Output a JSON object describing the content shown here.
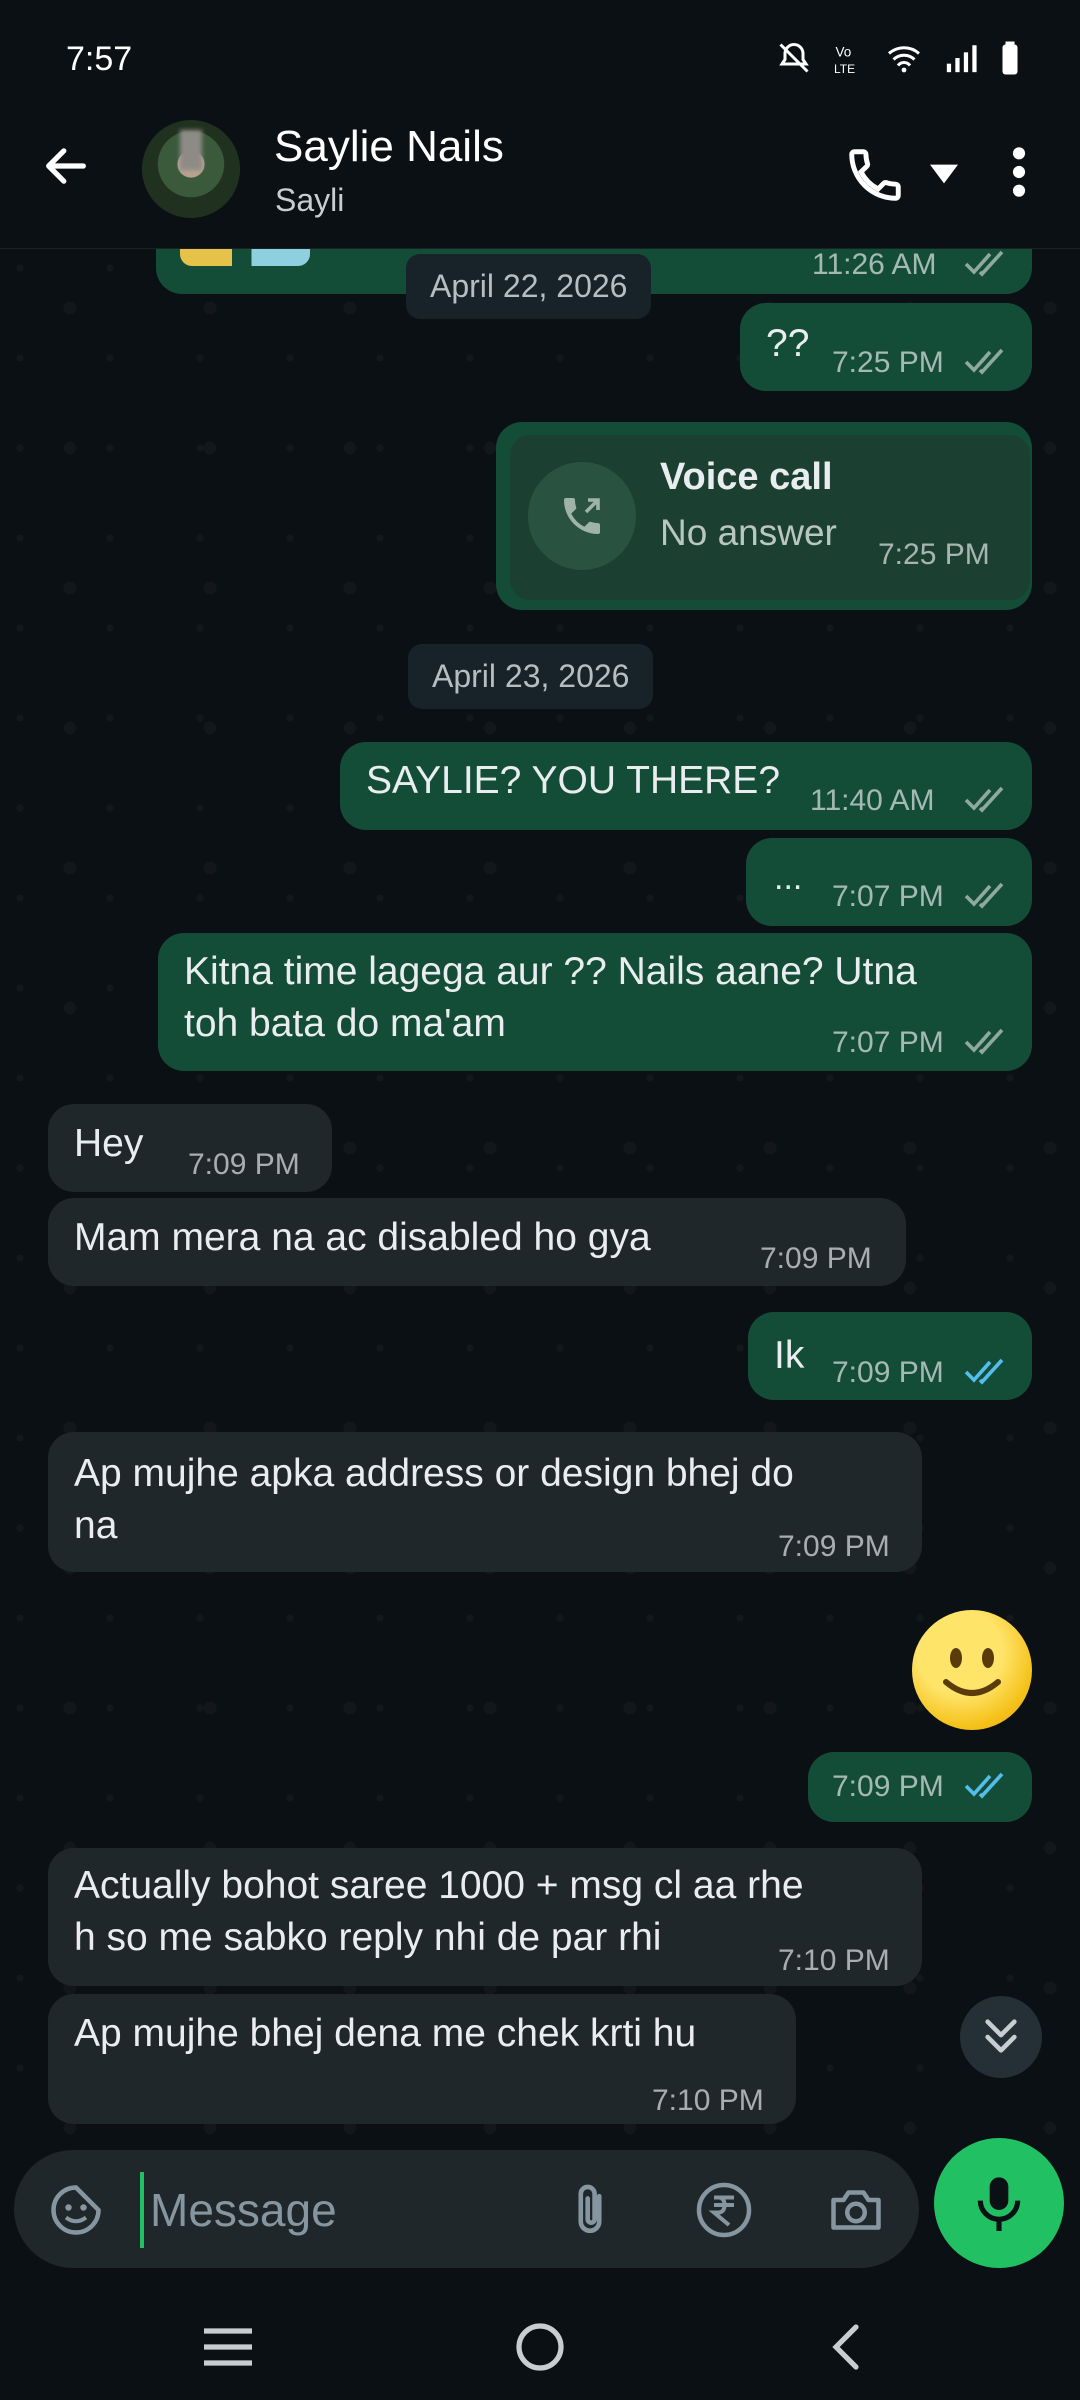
{
  "status_bar": {
    "time": "7:57"
  },
  "header": {
    "contact_name": "Saylie Nails",
    "contact_subtitle": "Sayli"
  },
  "dates": {
    "d1": "April 22, 2026",
    "d2": "April 23, 2026"
  },
  "messages": [
    {
      "side": "out",
      "text": "",
      "time": "11:26 AM",
      "status": "delivered"
    },
    {
      "side": "out",
      "text": "??",
      "time": "7:25 PM",
      "status": "delivered"
    },
    {
      "side": "out",
      "type": "call",
      "title": "Voice call",
      "subtitle": "No answer",
      "time": "7:25 PM"
    },
    {
      "side": "out",
      "text": "SAYLIE? YOU THERE?",
      "time": "11:40 AM",
      "status": "delivered"
    },
    {
      "side": "out",
      "text": "...",
      "time": "7:07 PM",
      "status": "delivered"
    },
    {
      "side": "out",
      "text": "Kitna time lagega aur ?? Nails aane? Utna toh bata do ma'am",
      "line1": "Kitna time lagega aur ?? Nails aane? Utna",
      "line2": "toh bata do ma'am",
      "time": "7:07 PM",
      "status": "delivered"
    },
    {
      "side": "in",
      "text": "Hey",
      "time": "7:09 PM"
    },
    {
      "side": "in",
      "text": "Mam mera na ac disabled ho gya",
      "time": "7:09 PM"
    },
    {
      "side": "out",
      "text": "Ik",
      "time": "7:09 PM",
      "status": "read"
    },
    {
      "side": "in",
      "text": "Ap mujhe apka address or design bhej do na",
      "line1": "Ap mujhe apka address or design bhej do",
      "line2": "na",
      "time": "7:09 PM"
    },
    {
      "side": "out",
      "type": "emoji",
      "text": "🙂",
      "time": "7:09 PM",
      "status": "read"
    },
    {
      "side": "in",
      "text": "Actually bohot saree 1000 + msg cl aa rhe h so me sabko reply nhi de par rhi",
      "line1": "Actually bohot saree 1000 + msg cl aa rhe",
      "line2": "h so me sabko reply nhi de par rhi",
      "time": "7:10 PM"
    },
    {
      "side": "in",
      "text": "Ap mujhe bhej dena me chek krti hu",
      "time": "7:10 PM"
    }
  ],
  "composer": {
    "placeholder": "Message"
  },
  "icons": {
    "back": "arrow-left",
    "call": "phone",
    "more": "dots-vertical",
    "emoji": "sticker-smile",
    "attach": "paperclip",
    "payment": "rupee",
    "camera": "camera",
    "mic": "microphone",
    "scroll": "double-chevron-down",
    "nav_recent": "menu",
    "nav_home": "circle",
    "nav_back": "chevron-left"
  },
  "colors": {
    "background": "#0b1014",
    "outgoing_bubble": "#144d37",
    "incoming_bubble": "#1f272a",
    "accent": "#21c063",
    "read_tick": "#53bdeb"
  }
}
